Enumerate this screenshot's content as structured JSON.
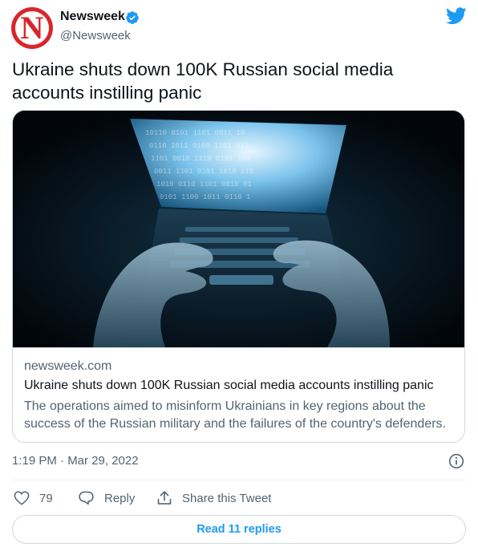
{
  "author": {
    "avatar_letter": "N",
    "display_name": "Newsweek",
    "handle": "@Newsweek",
    "verified_icon": "verified-badge-icon",
    "brand_icon": "twitter-bird-icon"
  },
  "tweet": {
    "text": "Ukraine shuts down 100K Russian social media accounts instilling panic",
    "timestamp": "1:19 PM · Mar 29, 2022"
  },
  "card": {
    "image_icon": "hands-typing-laptop-image",
    "domain": "newsweek.com",
    "title": "Ukraine shuts down 100K Russian social media accounts instilling panic",
    "description": "The operations aimed to misinform Ukrainians in key regions about the success of the Russian military and the failures of the country's defenders."
  },
  "actions": {
    "like_count": "79",
    "reply_label": "Reply",
    "share_label": "Share this Tweet"
  },
  "read_replies_label": "Read 11 replies",
  "colors": {
    "accent": "#1d9bf0",
    "brand_red": "#d8262c",
    "secondary_text": "#536471",
    "border": "#cfd9de"
  }
}
